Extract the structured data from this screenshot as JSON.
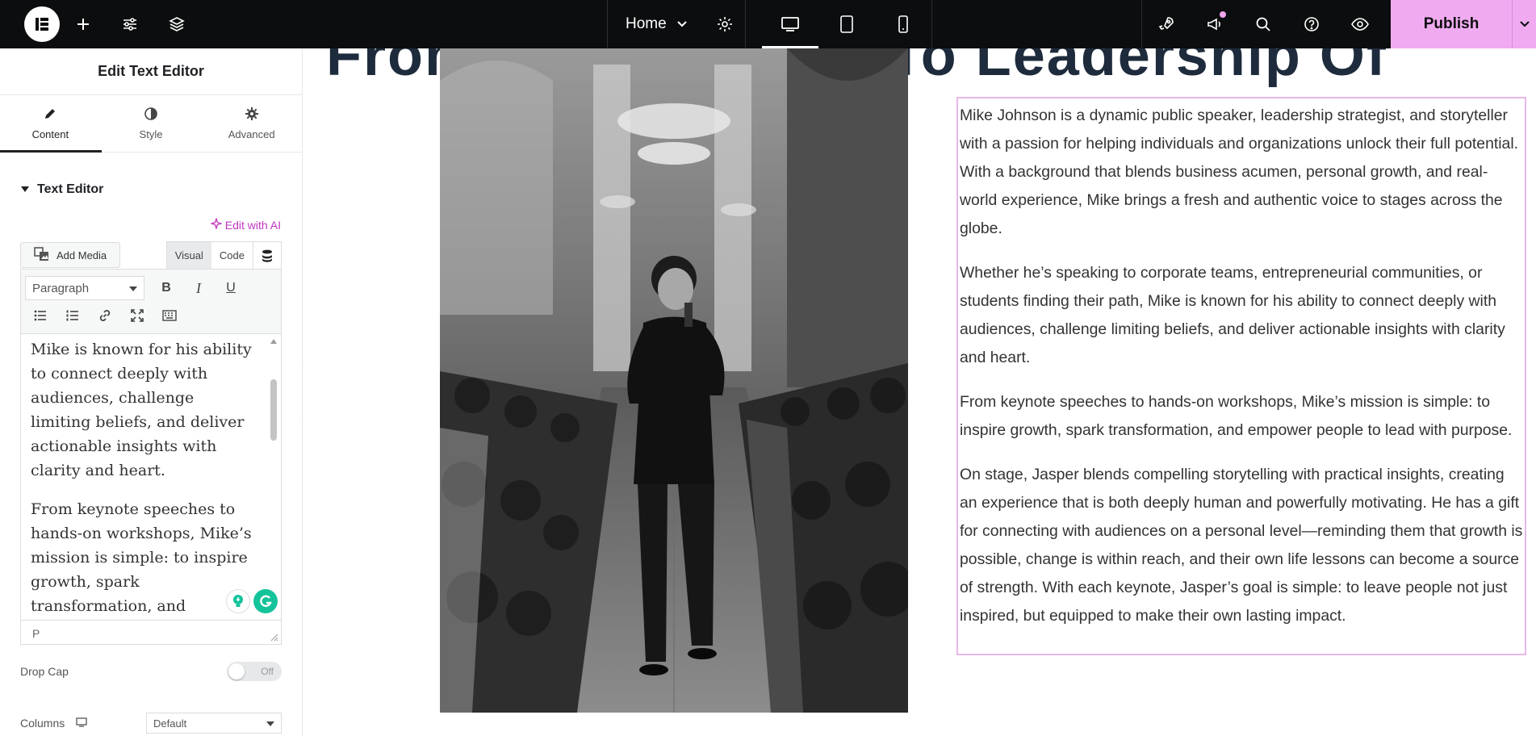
{
  "topbar": {
    "page_name": "Home",
    "publish_label": "Publish"
  },
  "panel": {
    "title": "Edit Text Editor",
    "tabs": [
      {
        "label": "Content",
        "icon": "pencil-icon"
      },
      {
        "label": "Style",
        "icon": "half-circle-icon"
      },
      {
        "label": "Advanced",
        "icon": "gear-icon"
      }
    ],
    "section_title": "Text Editor",
    "edit_ai_label": "Edit with AI",
    "add_media_label": "Add Media",
    "visual_label": "Visual",
    "code_label": "Code",
    "format_value": "Paragraph",
    "editor_paragraphs": [
      "Mike is known for his ability to connect deeply with audiences, challenge limiting beliefs, and deliver actionable insights with clarity and heart.",
      "From keynote speeches to hands-on workshops, Mike’s mission is simple: to inspire growth, spark transformation, and empower people to lead with purpose."
    ],
    "editor_status": "P",
    "drop_cap_label": "Drop Cap",
    "drop_cap_value": "Off",
    "columns_label": "Columns",
    "columns_value": "Default"
  },
  "canvas": {
    "heading": "From Life Lessons To Leadership Of",
    "paragraphs": [
      "Mike Johnson is a dynamic public speaker, leadership strategist, and storyteller with a passion for helping individuals and organizations unlock their full potential. With a background that blends business acumen, personal growth, and real-world experience, Mike brings a fresh and authentic voice to stages across the globe.",
      "Whether he’s speaking to corporate teams, entrepreneurial communities, or students finding their path, Mike is known for his ability to connect deeply with audiences, challenge limiting beliefs, and deliver actionable insights with clarity and heart.",
      "From keynote speeches to hands-on workshops, Mike’s mission is simple: to inspire growth, spark transformation, and empower people to lead with purpose.",
      "On stage, Jasper blends compelling storytelling with practical insights, creating an experience that is both deeply human and powerfully motivating. He has a gift for connecting with audiences on a personal level—reminding them that growth is possible, change is within reach, and their own life lessons can become a source of strength. With each keynote, Jasper’s goal is simple: to leave people not just inspired, but equipped to make their own lasting impact."
    ]
  },
  "colors": {
    "topbar_bg": "#0c0d0e",
    "publish_bg": "#f0abf0",
    "ai_accent": "#c036c0",
    "selection_border": "#e7b7e7"
  }
}
